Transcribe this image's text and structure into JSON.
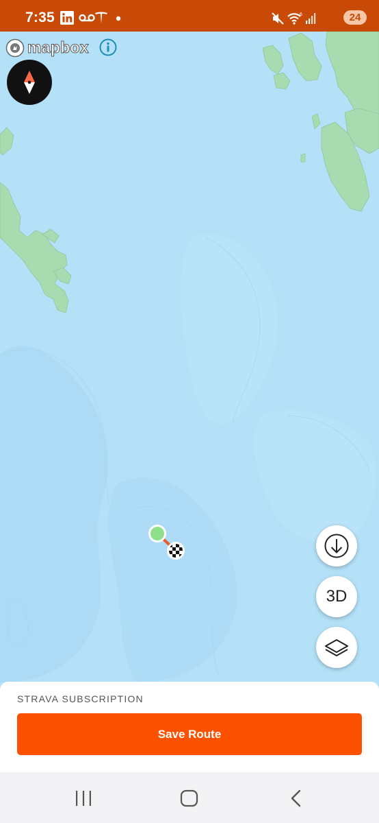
{
  "status_bar": {
    "time": "7:35",
    "left_icons": [
      "linkedin-icon",
      "voicemail-icon",
      "tesla-icon",
      "dot-icon"
    ],
    "right_icons": [
      "mute-icon",
      "wifi-icon",
      "signal-icon"
    ],
    "battery": "24"
  },
  "map": {
    "attribution": "mapbox",
    "water_color": "#b4e1f8",
    "land_color": "#a8dcb0",
    "route_color": "#e85a2a",
    "start_marker_color": "#8ee08a"
  },
  "controls": {
    "download_icon": "download-icon",
    "three_d_label": "3D",
    "layers_icon": "layers-icon"
  },
  "bottom_sheet": {
    "subscription_label": "STRAVA SUBSCRIPTION",
    "save_button_label": "Save Route",
    "button_color": "#fc5200"
  },
  "nav_bar": {
    "recents_icon": "recents-icon",
    "home_icon": "home-icon",
    "back_icon": "back-icon"
  }
}
